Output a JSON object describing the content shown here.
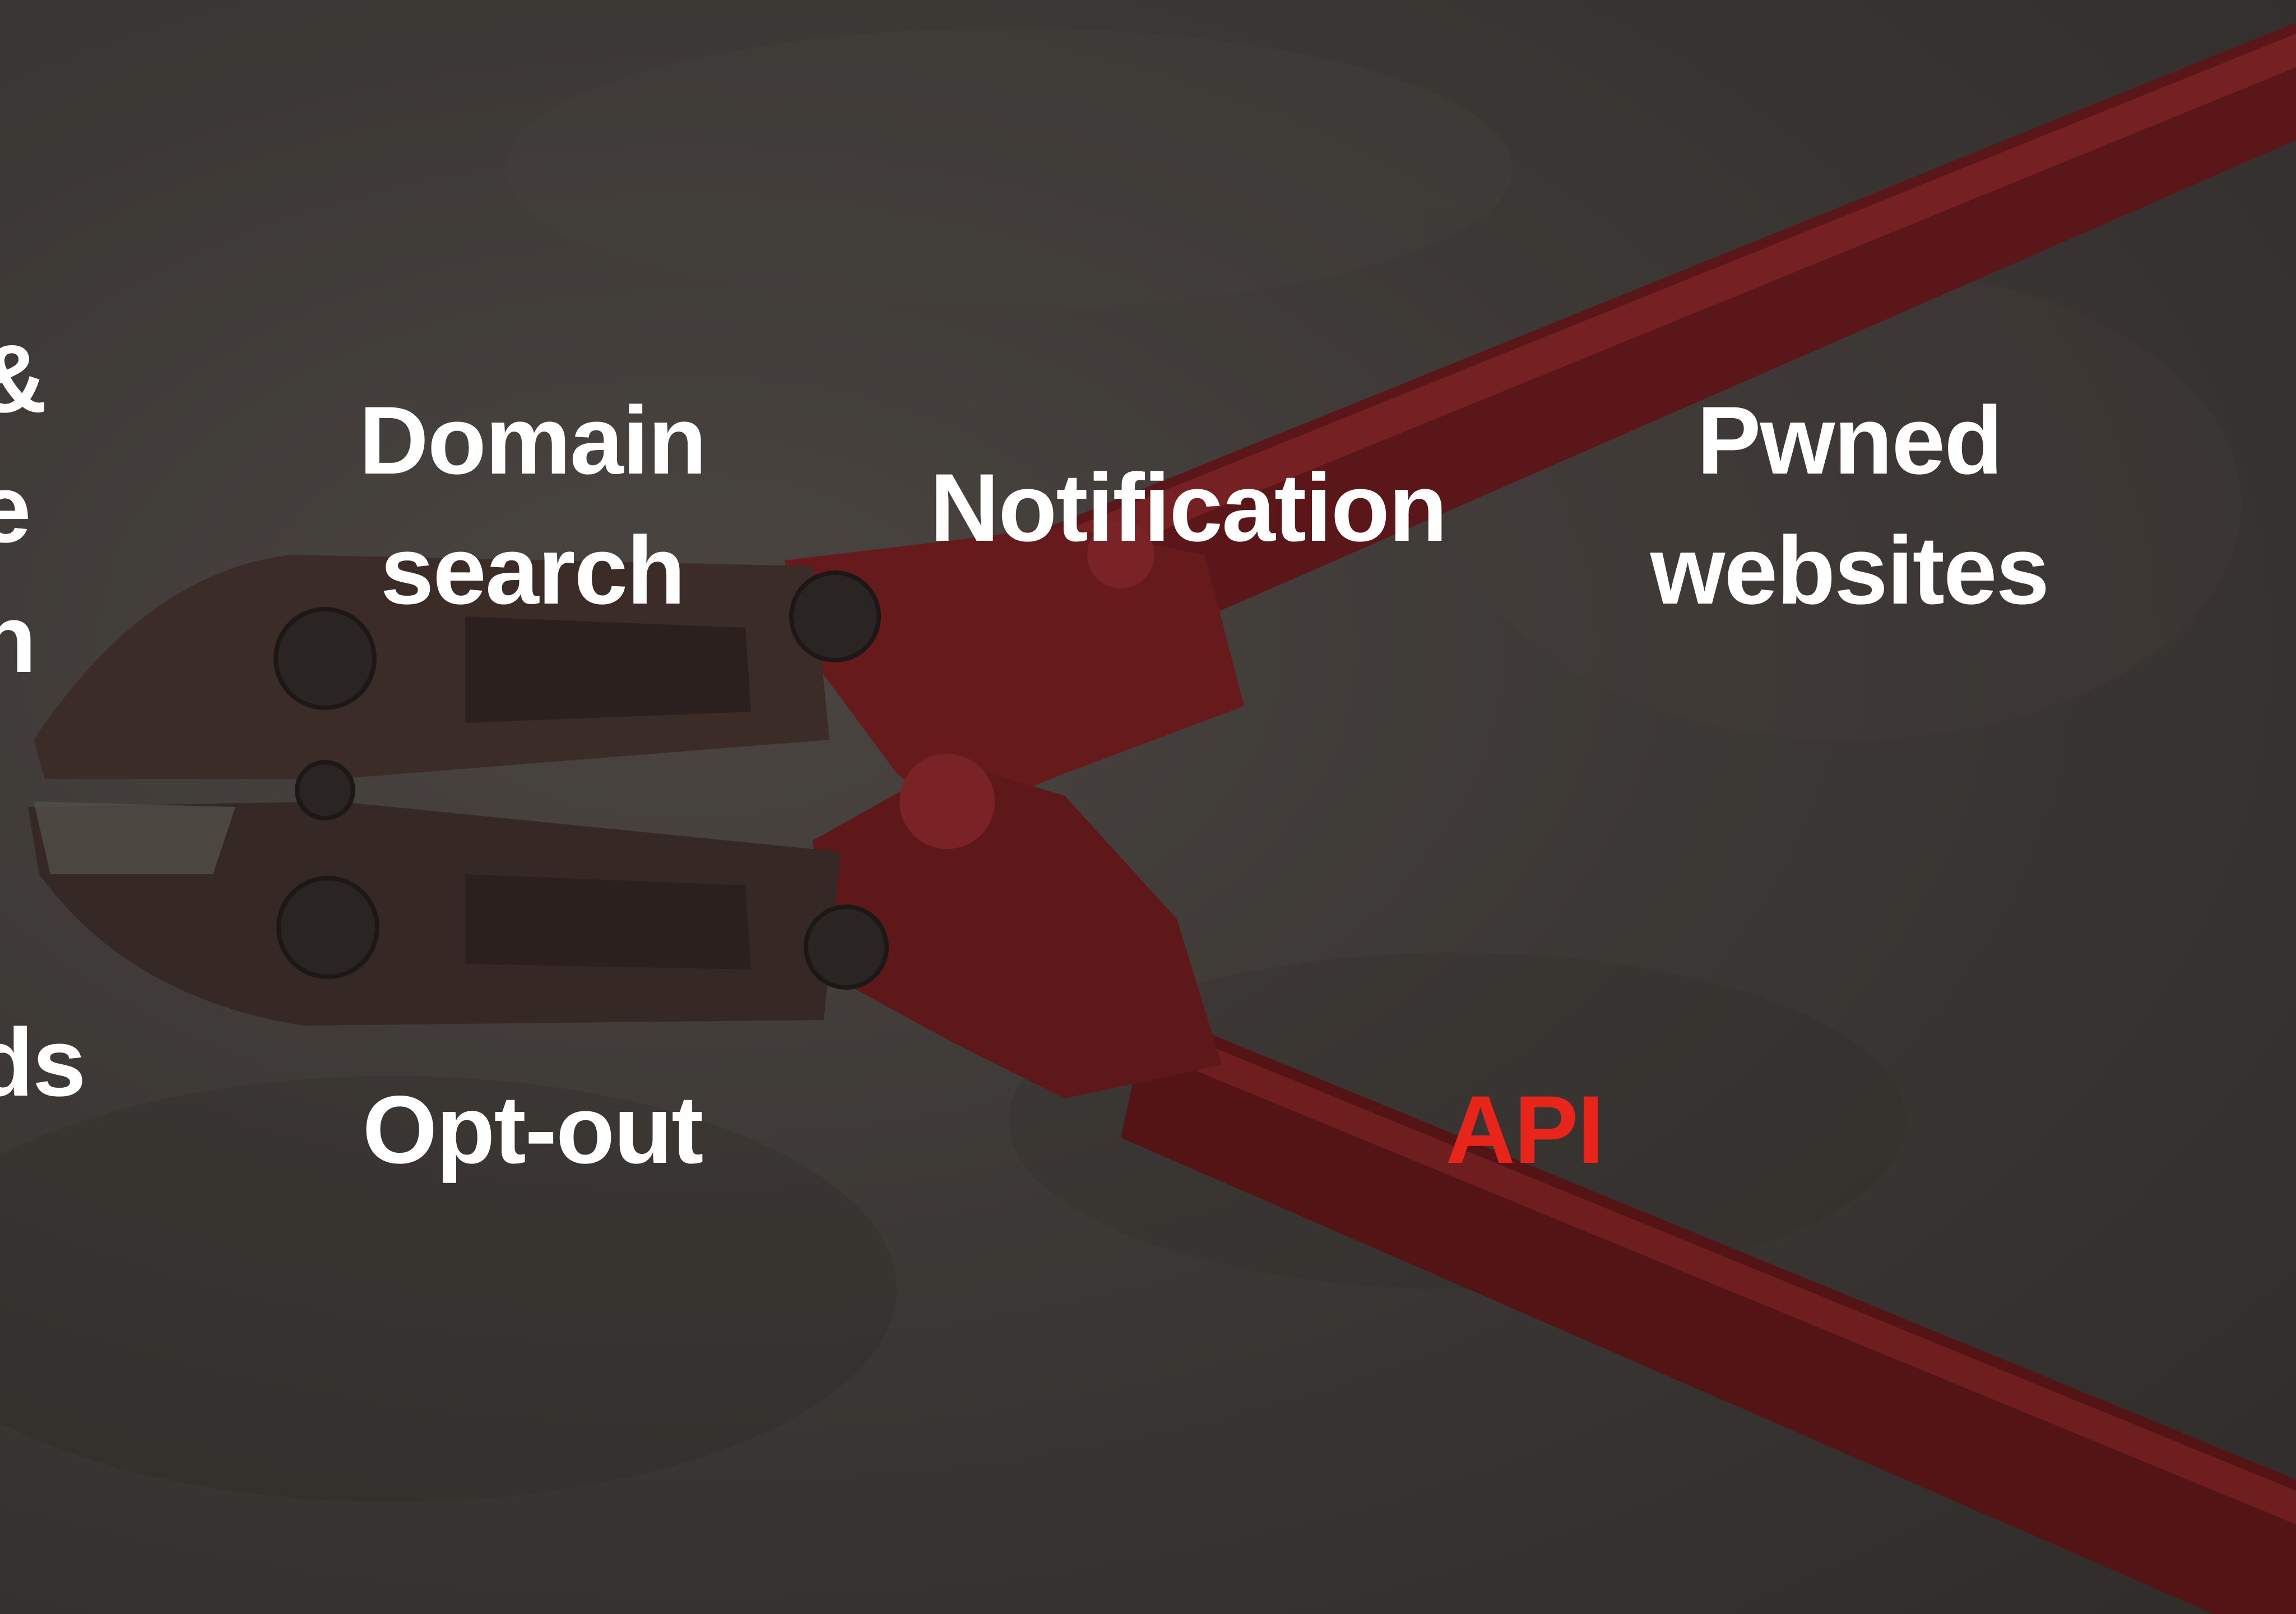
{
  "colors": {
    "background": "#3a3633",
    "text": "#ffffff",
    "accent": "#e8251b",
    "handle": "#6b1a1c"
  },
  "features": {
    "left_cut_top": "&\ne\nh",
    "left_cut_bottom": "rds\nh",
    "domain_search": "Domain\nsearch",
    "notification": "Notification",
    "pwned_websites": "Pwned\nwebsites",
    "opt_out": "Opt-out",
    "api": "API"
  },
  "icons": {
    "background": "bolt-cutter-photo"
  }
}
